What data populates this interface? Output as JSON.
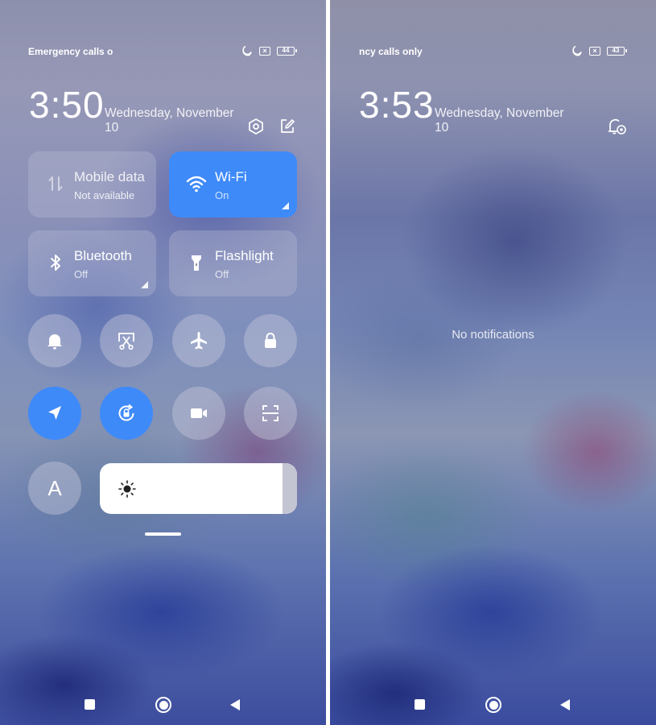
{
  "control_center": {
    "status": {
      "carrier": "Emergency calls o",
      "battery": "44"
    },
    "clock": {
      "time": "3:50",
      "date_line1": "Wednesday, November",
      "date_line2": "10"
    },
    "tiles": [
      {
        "title": "Mobile data",
        "subtitle": "Not available",
        "state": "disabled",
        "icon": "mobile-data-icon"
      },
      {
        "title": "Wi-Fi",
        "subtitle": "On",
        "state": "on",
        "icon": "wifi-icon"
      },
      {
        "title": "Bluetooth",
        "subtitle": "Off",
        "state": "off",
        "icon": "bluetooth-icon"
      },
      {
        "title": "Flashlight",
        "subtitle": "Off",
        "state": "off",
        "icon": "flashlight-icon"
      }
    ],
    "toggles_row1": [
      {
        "name": "bell",
        "state": "off"
      },
      {
        "name": "screenshot",
        "state": "off"
      },
      {
        "name": "airplane",
        "state": "off"
      },
      {
        "name": "lock",
        "state": "off"
      }
    ],
    "toggles_row2": [
      {
        "name": "location",
        "state": "on"
      },
      {
        "name": "rotation-lock",
        "state": "on"
      },
      {
        "name": "screen-record",
        "state": "off"
      },
      {
        "name": "scanner",
        "state": "off"
      }
    ],
    "auto_brightness_label": "A",
    "accent_color": "#3f8af9"
  },
  "notification_shade": {
    "status": {
      "carrier": "ncy calls only",
      "battery": "43"
    },
    "clock": {
      "time": "3:53",
      "date_line1": "Wednesday, November",
      "date_line2": "10"
    },
    "empty_message": "No notifications"
  }
}
